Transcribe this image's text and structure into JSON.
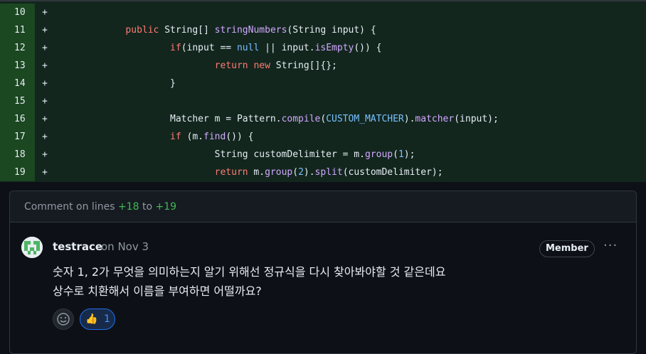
{
  "diff": {
    "lines": [
      {
        "num": "10",
        "sign": "+",
        "segments": [
          {
            "t": "",
            "c": ""
          }
        ]
      },
      {
        "num": "11",
        "sign": "+",
        "segments": [
          {
            "t": "        ",
            "c": ""
          },
          {
            "t": "public",
            "c": "kw"
          },
          {
            "t": " String[] ",
            "c": ""
          },
          {
            "t": "stringNumbers",
            "c": "fn"
          },
          {
            "t": "(String input) {",
            "c": ""
          }
        ]
      },
      {
        "num": "12",
        "sign": "+",
        "segments": [
          {
            "t": "                ",
            "c": ""
          },
          {
            "t": "if",
            "c": "kw"
          },
          {
            "t": "(input == ",
            "c": ""
          },
          {
            "t": "null",
            "c": "cst"
          },
          {
            "t": " || input.",
            "c": ""
          },
          {
            "t": "isEmpty",
            "c": "fn"
          },
          {
            "t": "()) {",
            "c": ""
          }
        ]
      },
      {
        "num": "13",
        "sign": "+",
        "segments": [
          {
            "t": "                        ",
            "c": ""
          },
          {
            "t": "return",
            "c": "kw"
          },
          {
            "t": " ",
            "c": ""
          },
          {
            "t": "new",
            "c": "kw"
          },
          {
            "t": " String[]{};",
            "c": ""
          }
        ]
      },
      {
        "num": "14",
        "sign": "+",
        "segments": [
          {
            "t": "                }",
            "c": ""
          }
        ]
      },
      {
        "num": "15",
        "sign": "+",
        "segments": [
          {
            "t": "",
            "c": ""
          }
        ]
      },
      {
        "num": "16",
        "sign": "+",
        "segments": [
          {
            "t": "                Matcher m = Pattern.",
            "c": ""
          },
          {
            "t": "compile",
            "c": "fn"
          },
          {
            "t": "(",
            "c": ""
          },
          {
            "t": "CUSTOM_MATCHER",
            "c": "cst"
          },
          {
            "t": ").",
            "c": ""
          },
          {
            "t": "matcher",
            "c": "fn"
          },
          {
            "t": "(input);",
            "c": ""
          }
        ]
      },
      {
        "num": "17",
        "sign": "+",
        "segments": [
          {
            "t": "                ",
            "c": ""
          },
          {
            "t": "if",
            "c": "kw"
          },
          {
            "t": " (m.",
            "c": ""
          },
          {
            "t": "find",
            "c": "fn"
          },
          {
            "t": "()) {",
            "c": ""
          }
        ]
      },
      {
        "num": "18",
        "sign": "+",
        "segments": [
          {
            "t": "                        String customDelimiter = m.",
            "c": ""
          },
          {
            "t": "group",
            "c": "fn"
          },
          {
            "t": "(",
            "c": ""
          },
          {
            "t": "1",
            "c": "cst"
          },
          {
            "t": ");",
            "c": ""
          }
        ]
      },
      {
        "num": "19",
        "sign": "+",
        "segments": [
          {
            "t": "                        ",
            "c": ""
          },
          {
            "t": "return",
            "c": "kw"
          },
          {
            "t": " m.",
            "c": ""
          },
          {
            "t": "group",
            "c": "fn"
          },
          {
            "t": "(",
            "c": ""
          },
          {
            "t": "2",
            "c": "cst"
          },
          {
            "t": ").",
            "c": ""
          },
          {
            "t": "split",
            "c": "fn"
          },
          {
            "t": "(customDelimiter);",
            "c": ""
          }
        ]
      }
    ]
  },
  "thread": {
    "header_prefix": "Comment on lines",
    "from": "+18",
    "to_word": "to",
    "to": "+19"
  },
  "comment": {
    "author": "testrace",
    "date": "on Nov 3",
    "badge": "Member",
    "more_label": "···",
    "body_line1": "숫자 1, 2가 무엇을 의미하는지 알기 위해선 정규식을 다시 찾아봐야할 것 같은데요",
    "body_line2": "상수로 치환해서 이름을 부여하면 어떨까요?",
    "reaction_emoji": "👍",
    "reaction_count": "1"
  },
  "colors": {
    "addition_bg": "#12261e",
    "line_number_bg": "#1b4721",
    "accent": "#1f6feb"
  }
}
